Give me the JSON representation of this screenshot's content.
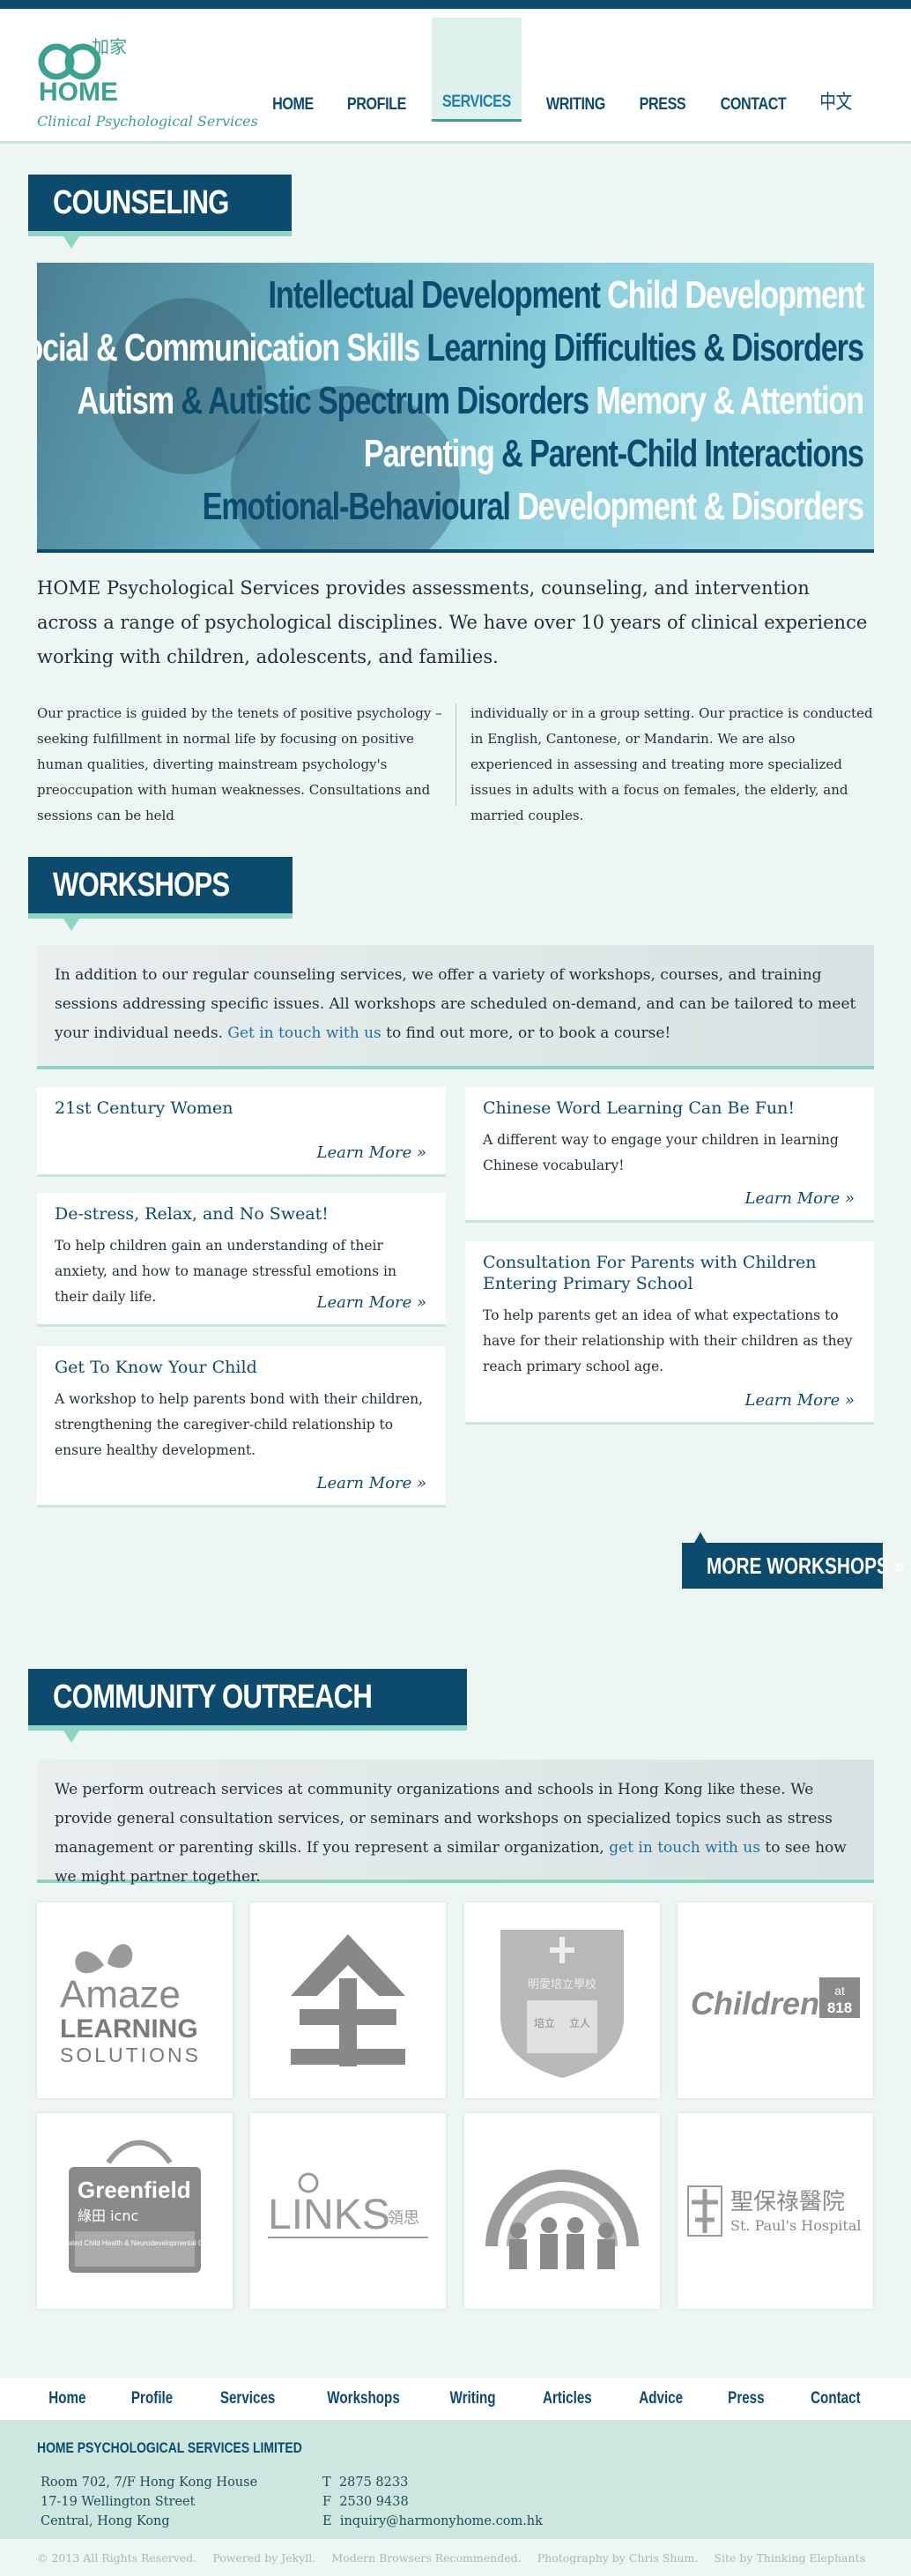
{
  "site": {
    "logo_cjk": "加家",
    "logo_word": "HOME",
    "tagline": "Clinical Psychological Services"
  },
  "nav": [
    {
      "label": "Home",
      "active": false
    },
    {
      "label": "Profile",
      "active": false
    },
    {
      "label": "Services",
      "active": true
    },
    {
      "label": "Writing",
      "active": false
    },
    {
      "label": "Press",
      "active": false
    },
    {
      "label": "Contact",
      "active": false
    },
    {
      "label": "中文",
      "active": false
    }
  ],
  "counseling": {
    "heading": "COUNSELING",
    "banner": [
      [
        [
          "b",
          "Intellectual Development"
        ],
        [
          "w",
          " Child Development"
        ]
      ],
      [
        [
          "w",
          "Social & Communication Skills"
        ],
        [
          "b",
          " Learning Difficulties & Disorders"
        ]
      ],
      [
        [
          "w",
          "Autism"
        ],
        [
          "b",
          " & Autistic Spectrum Disorders"
        ],
        [
          "w",
          " Memory & Attention"
        ]
      ],
      [
        [
          "w",
          "Parenting"
        ],
        [
          "b",
          " & Parent-Child Interactions"
        ]
      ],
      [
        [
          "b",
          "Emotional-Behavioural"
        ],
        [
          "w",
          " Development & Disorders"
        ]
      ]
    ],
    "lead": "HOME Psychological Services provides assessments, counseling, and intervention across a range of psychological disciplines. We have over 10 years of clinical experience working with children, adolescents, and families.",
    "col1": "Our practice is guided by the tenets of positive psychology – seeking fulfillment in normal life by focusing on positive human qualities, diverting mainstream psychology's preoccupation with human weaknesses. Consultations and sessions can be held",
    "col2": "individually or in a group setting. Our practice is conducted in English, Cantonese, or Mandarin. We are also experienced in assessing and treating more specialized issues in adults with a focus on females, the elderly, and married couples."
  },
  "workshops": {
    "heading": "WORKSHOPS",
    "intro_before": "In addition to our regular counseling services, we offer a variety of workshops, courses, and training sessions addressing specific issues. All workshops are scheduled on-demand, and can be tailored to meet your individual needs. ",
    "intro_link": "Get in touch with us",
    "intro_after": " to find out more, or to book a course!",
    "learn_more": "Learn More »",
    "items": [
      {
        "title": "21st Century Women",
        "desc": ""
      },
      {
        "title": "De-stress, Relax, and No Sweat!",
        "desc": "To help children gain an understanding of their anxiety, and how to manage stressful emotions in their daily life."
      },
      {
        "title": "Get To Know Your Child",
        "desc": "A workshop to help parents bond with their children, strengthening the caregiver-child relationship to ensure healthy development."
      },
      {
        "title": "Chinese Word Learning Can Be Fun!",
        "desc": "A different way to engage your children in learning Chinese vocabulary!"
      },
      {
        "title": "Consultation For Parents with Children Entering Primary School",
        "desc": "To help parents get an idea of what expectations to have for their relationship with their children as they reach primary school age."
      }
    ],
    "more_button": "MORE WORKSHOPS »"
  },
  "outreach": {
    "heading": "COMMUNITY OUTREACH",
    "intro_before": "We perform outreach services at community organizations and schools in Hong Kong like these. We provide general consultation services, or seminars and workshops on specialized topics such as stress management or parenting skills. If you represent a similar organization, ",
    "intro_link": "get in touch with us",
    "intro_after": " to see how we might partner together.",
    "partners": [
      {
        "name": "Amaze Learning Solutions",
        "line1": "Amaze",
        "line2": "LEARNING",
        "line3": "SOLUTIONS"
      },
      {
        "name": "Caritas"
      },
      {
        "name": "Catholic school crest",
        "line1": "明愛培立學校",
        "line2": "培立",
        "line3": "立人"
      },
      {
        "name": "Children at 818",
        "line1": "Children",
        "line2": "at",
        "line3": "818"
      },
      {
        "name": "Greenfield icnc",
        "line1": "Greenfield",
        "line2": "綠田 icnc",
        "line3": "Integrated Child Health & Neurodevelopmental Centre"
      },
      {
        "name": "Links",
        "line1": "LINKS",
        "line2": "領思"
      },
      {
        "name": "Rainbow children"
      },
      {
        "name": "St. Paul's Hospital",
        "line1": "聖保祿醫院",
        "line2": "St. Paul's Hospital"
      }
    ]
  },
  "footer_nav": [
    "Home",
    "Profile",
    "Services",
    "Workshops",
    "Writing",
    "Articles",
    "Advice",
    "Press",
    "Contact"
  ],
  "footer": {
    "company": "HOME PSYCHOLOGICAL SERVICES LIMITED",
    "address": [
      "Room 702, 7/F Hong Kong House",
      "17-19 Wellington Street",
      "Central, Hong Kong"
    ],
    "contact": [
      {
        "k": "T",
        "v": "2875 8233"
      },
      {
        "k": "F",
        "v": "2530 9438"
      },
      {
        "k": "E",
        "v": "inquiry@harmonyhome.com.hk"
      }
    ],
    "bottom": [
      "© 2013 All Rights Reserved.",
      "Powered by Jekyll.",
      "Modern Browsers Recommended.",
      "Photography by Chris Shum.",
      "Site by Thinking Elephants"
    ]
  },
  "colors": {
    "primary": "#0c4a6e",
    "accent": "#3aa28f",
    "mint": "#8fd4c3"
  }
}
